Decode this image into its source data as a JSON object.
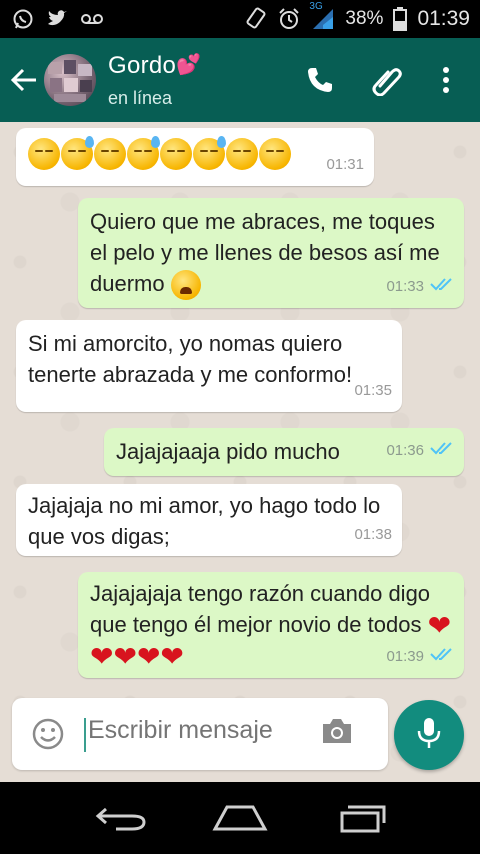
{
  "status_bar": {
    "network": "3G",
    "battery": "38%",
    "time": "01:39"
  },
  "header": {
    "contact_name": "Gordo",
    "contact_emoji": "💕",
    "status": "en línea"
  },
  "messages": [
    {
      "side": "in",
      "text": "",
      "emojis": [
        "sleepy",
        "sweat",
        "sleepy",
        "sweat",
        "sleepy",
        "sweat",
        "pensive",
        "pensive"
      ],
      "time": "01:31"
    },
    {
      "side": "out",
      "text": "Quiero que me abraces, me toques el pelo y me llenes de besos así me duermo",
      "trailing_emoji": "weary",
      "time": "01:33",
      "ticks": "read"
    },
    {
      "side": "in",
      "text": "Si mi amorcito, yo nomas quiero tenerte abrazada y me conformo!",
      "time": "01:35"
    },
    {
      "side": "out",
      "text": "Jajajajaaja pido mucho",
      "time": "01:36",
      "ticks": "read"
    },
    {
      "side": "in",
      "text": "Jajajaja no mi amor, yo hago todo lo que vos digas;",
      "time": "01:38"
    },
    {
      "side": "out",
      "text": "Jajajajaja tengo razón cuando digo que tengo él mejor novio de todos",
      "hearts": 5,
      "time": "01:39",
      "ticks": "read"
    }
  ],
  "composer": {
    "placeholder": "Escribir mensaje"
  },
  "colors": {
    "app_bar": "#075e54",
    "outgoing_bubble": "#dcf8c6",
    "incoming_bubble": "#ffffff",
    "mic_button": "#128c7e",
    "read_ticks": "#4fc3f7"
  },
  "icons": {
    "status_left": [
      "whatsapp-icon",
      "twitter-icon",
      "voicemail-icon"
    ],
    "status_right": [
      "rotation-icon",
      "alarm-icon",
      "signal-icon",
      "battery-icon"
    ],
    "app_bar": [
      "back-arrow-icon",
      "phone-icon",
      "attach-icon",
      "more-icon"
    ],
    "composer": [
      "emoji-icon",
      "camera-icon",
      "mic-icon"
    ],
    "nav": [
      "back-icon",
      "home-icon",
      "recents-icon"
    ]
  }
}
